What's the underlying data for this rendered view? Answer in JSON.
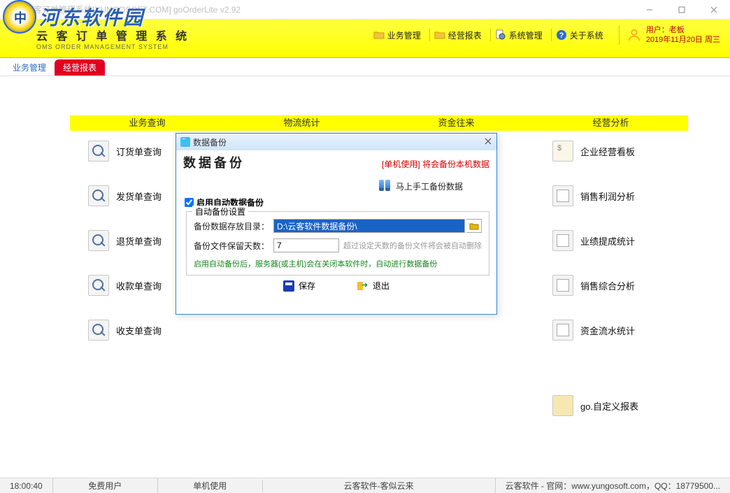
{
  "window": {
    "title": "云客订单管理系统[YUNGOSOFT.COM]  goOrderLite v2.92"
  },
  "overlay": {
    "brand": "河东软件园"
  },
  "header": {
    "title_cn": "云 客 订 单 管 理 系 统",
    "title_en": "OMS ORDER MANAGEMENT SYSTEM",
    "menu": [
      {
        "label": "业务管理",
        "icon": "folder"
      },
      {
        "label": "经营报表",
        "icon": "folder"
      },
      {
        "label": "系统管理",
        "icon": "gear"
      },
      {
        "label": "关于系统",
        "icon": "help"
      }
    ],
    "user_label": "用户：老板",
    "date": "2019年11月20日 周三"
  },
  "tabs": [
    {
      "label": "业务管理",
      "active": false
    },
    {
      "label": "经营报表",
      "active": true
    }
  ],
  "categories": [
    "业务查询",
    "物流统计",
    "资金往来",
    "经营分析"
  ],
  "col1": [
    {
      "label": "订货单查询"
    },
    {
      "label": "发货单查询"
    },
    {
      "label": "退货单查询"
    },
    {
      "label": "收款单查询"
    },
    {
      "label": "收支单查询"
    }
  ],
  "col4": [
    {
      "label": "企业经营看板"
    },
    {
      "label": "销售利润分析"
    },
    {
      "label": "业绩提成统计"
    },
    {
      "label": "销售综合分析"
    },
    {
      "label": "资金流水统计"
    }
  ],
  "col4_extra": {
    "label": "go.自定义报表"
  },
  "modal": {
    "window_title": "数据备份",
    "heading": "数据备份",
    "heading_note": "[单机使用] 将会备份本机数据",
    "manual_btn": "马上手工备份数据",
    "enable_label": "启用自动数据备份",
    "enable_checked": true,
    "fieldset_legend": "自动备份设置",
    "path_label": "备份数据存放目录：",
    "path_value": "D:\\云客软件数据备份\\",
    "days_label": "备份文件保留天数：",
    "days_value": "7",
    "days_hint": "超过设定天数的备份文件将会被自动删除",
    "note": "启用自动备份后，服务器(或主机)会在关闭本软件时，自动进行数据备份",
    "save_btn": "保存",
    "exit_btn": "退出"
  },
  "statusbar": {
    "time": "18:00:40",
    "c1": "免费用户",
    "c2": "单机使用",
    "c3": "云客软件-客似云来",
    "right": "云客软件 - 官网：www.yungosoft.com，QQ：18779500..."
  }
}
